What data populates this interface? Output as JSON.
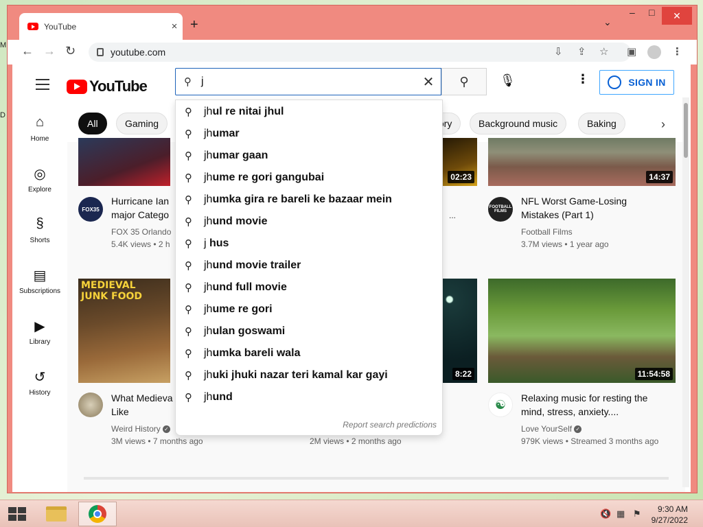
{
  "desktop": {
    "edge_label_1": "M",
    "edge_label_2": "D"
  },
  "browser": {
    "tab_title": "YouTube",
    "tab_close": "×",
    "new_tab": "+",
    "url": "youtube.com",
    "window_controls": {
      "collapse": "⌄",
      "minimize": "–",
      "maximize": "□",
      "close": "✕"
    }
  },
  "youtube": {
    "logo_text": "YouTube",
    "search": {
      "value": "j",
      "clear": "✕"
    },
    "signin_label": "SIGN IN",
    "chips": [
      "All",
      "Gaming",
      "tory",
      "Background music",
      "Baking"
    ],
    "sidebar": [
      {
        "label": "Home",
        "icon": "home-icon"
      },
      {
        "label": "Explore",
        "icon": "compass-icon"
      },
      {
        "label": "Shorts",
        "icon": "shorts-icon"
      },
      {
        "label": "Subscriptions",
        "icon": "subscriptions-icon"
      },
      {
        "label": "Library",
        "icon": "library-icon"
      },
      {
        "label": "History",
        "icon": "history-icon"
      }
    ],
    "suggestions": [
      [
        "jh",
        "ul re nitai jhul"
      ],
      [
        "jh",
        "umar"
      ],
      [
        "jh",
        "umar gaan"
      ],
      [
        "jh",
        "ume re gori gangubai"
      ],
      [
        "jh",
        "umka gira re bareli ke bazaar mein"
      ],
      [
        "jh",
        "und movie"
      ],
      [
        "j",
        " hus"
      ],
      [
        "jh",
        "und movie trailer"
      ],
      [
        "jh",
        "und full movie"
      ],
      [
        "jh",
        "ume re gori"
      ],
      [
        "jh",
        "ulan goswami"
      ],
      [
        "jh",
        "umka bareli wala"
      ],
      [
        "jh",
        "uki jhuki nazar teri kamal kar gayi"
      ],
      [
        "jh",
        "und"
      ]
    ],
    "report_label": "Report search predictions",
    "videos": [
      {
        "title_1": "Hurricane Ian",
        "title_2": "major Catego",
        "channel": "FOX 35 Orlando",
        "meta": "5.4K views • 2 h",
        "avatar_text": "FOX35"
      },
      {
        "duration": "02:23",
        "meta_tail": "..."
      },
      {
        "title_1": "NFL Worst Game-Losing",
        "title_2": "Mistakes (Part 1)",
        "channel": "Football Films",
        "meta": "3.7M views • 1 year ago",
        "duration": "14:37",
        "avatar_text": "FOOTBALL FILMS"
      },
      {
        "title_1": "What Medieva",
        "title_2": "Like",
        "channel": "Weird History",
        "meta": "3M views • 7 months ago",
        "thumb_text_1": "MEDIEVAL",
        "thumb_text_2": "JUNK FOOD"
      },
      {
        "duration": "8:22",
        "meta": "2M views • 2 months ago"
      },
      {
        "title_1": "Relaxing music for resting the",
        "title_2": "mind, stress, anxiety....",
        "channel": "Love YourSelf",
        "meta": "979K views • Streamed 3 months ago",
        "duration": "11:54:58"
      }
    ]
  },
  "taskbar": {
    "time": "9:30 AM",
    "date": "9/27/2022"
  },
  "colors": {
    "yt_red": "#ff0000",
    "signin_blue": "#065fd4",
    "window_frame": "#f08a80"
  }
}
